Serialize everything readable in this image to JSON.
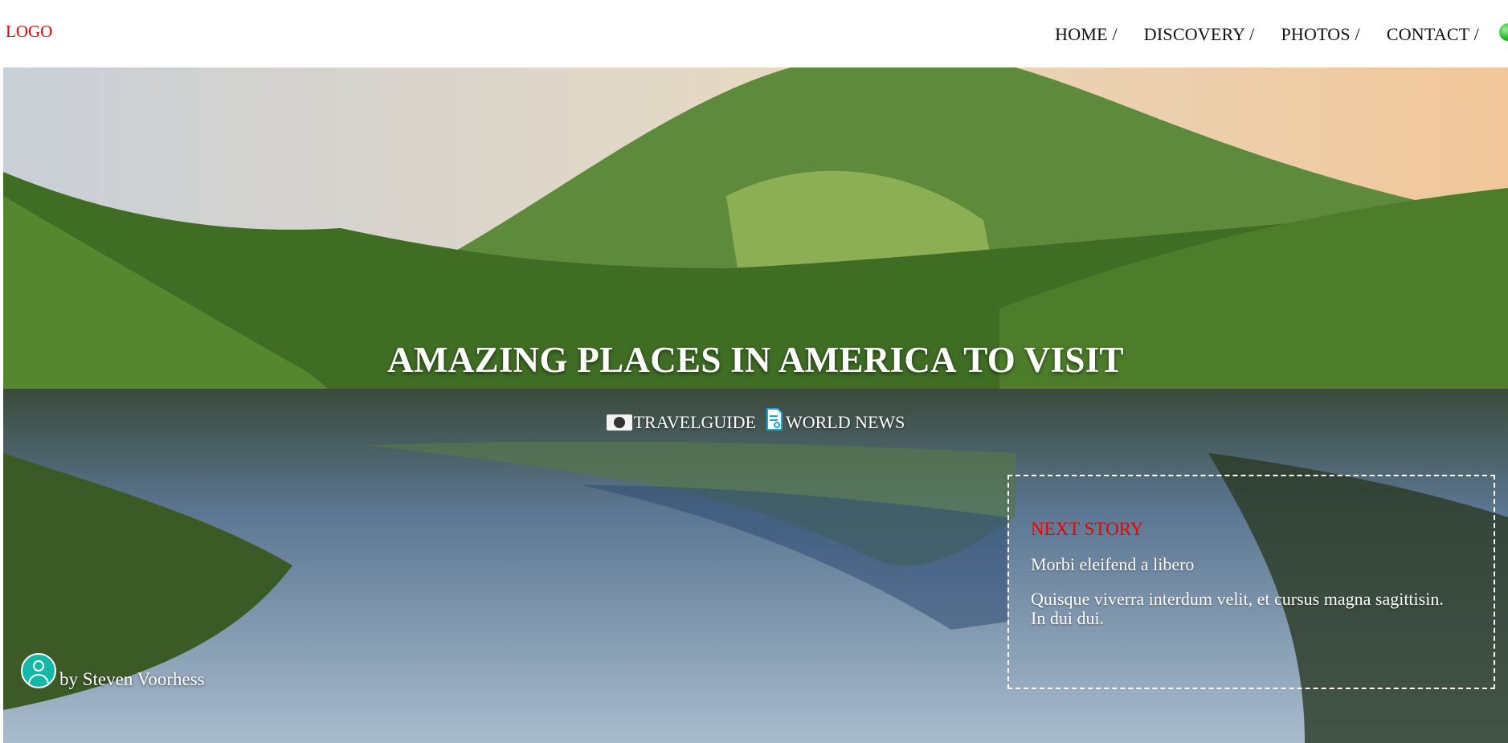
{
  "header": {
    "logo": "LOGO",
    "nav": [
      {
        "label": "HOME /"
      },
      {
        "label": "DISCOVERY /"
      },
      {
        "label": "PHOTOS /"
      },
      {
        "label": "CONTACT /"
      }
    ],
    "globe_icon": "globe-icon"
  },
  "hero": {
    "title": "AMAZING PLACES IN AMERICA TO VISIT",
    "tags": [
      {
        "icon": "travel-icon",
        "label": "TRAVELGUIDE"
      },
      {
        "icon": "news-document-icon",
        "label": "WORLD NEWS"
      }
    ],
    "author": {
      "label": "by Steven Voorhess",
      "icon": "user-avatar-icon"
    }
  },
  "next_story": {
    "heading": "NEXT STORY",
    "title": "Morbi eleifend a libero",
    "excerpt": "Quisque viverra interdum velit, et cursus magna sagittisin. In dui dui."
  },
  "colors": {
    "logo": "#ee0000",
    "accent": "#ee0000",
    "avatar": "#14b8a6"
  }
}
